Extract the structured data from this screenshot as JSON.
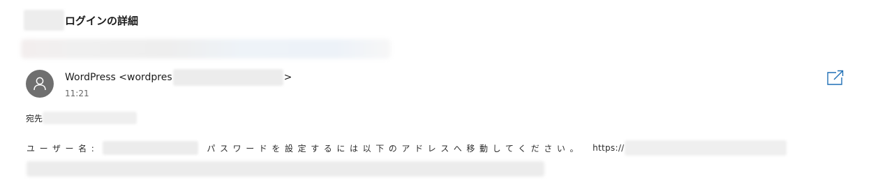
{
  "email": {
    "subject": "ログインの詳細",
    "sender": {
      "name_prefix": "WordPress <wordpres",
      "name_suffix": ">",
      "time": "11:21"
    },
    "recipient_label": "宛先",
    "body": {
      "username_label": "ユーザー名:",
      "instruction": "パスワードを設定するには以下のアドレスへ移動してください。",
      "url_prefix": "https://"
    }
  },
  "icons": {
    "avatar": "person-icon",
    "popout": "open-in-new-window-icon"
  },
  "colors": {
    "avatar_bg": "#6f6f6f",
    "popout_icon": "#1f6fb5",
    "redaction": "#ececec"
  }
}
